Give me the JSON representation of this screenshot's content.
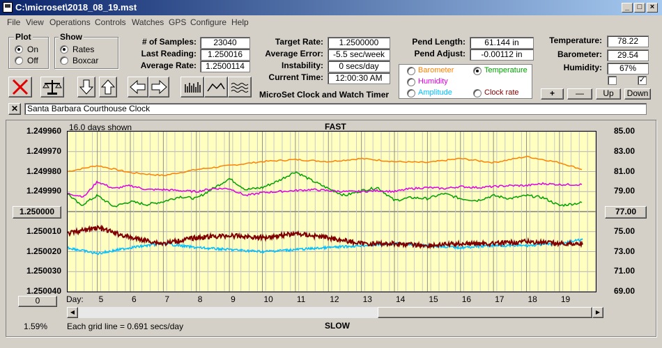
{
  "window": {
    "title": "C:\\microset\\2018_08_19.mst"
  },
  "menu": [
    "File",
    "View",
    "Operations",
    "Controls",
    "Watches",
    "GPS",
    "Configure",
    "Help"
  ],
  "plot_group": {
    "title": "Plot",
    "options": [
      "On",
      "Off"
    ],
    "selected": "On"
  },
  "show_group": {
    "title": "Show",
    "options": [
      "Rates",
      "Boxcar"
    ],
    "selected": "Rates"
  },
  "stats": {
    "samples_label": "# of Samples:",
    "samples_value": "23040",
    "last_label": "Last Reading:",
    "last_value": "1.250016",
    "avg_label": "Average Rate:",
    "avg_value": "1.2500114"
  },
  "targets": {
    "target_label": "Target Rate:",
    "target_value": "1.2500000",
    "error_label": "Average Error:",
    "error_value": "-5.5 sec/week",
    "instab_label": "Instability:",
    "instab_value": "0 secs/day",
    "time_label": "Current Time:",
    "time_value": "12:00:30 AM",
    "product_title": "MicroSet Clock and Watch Timer"
  },
  "pendulum": {
    "length_label": "Pend Length:",
    "length_value": "61.144 in",
    "adjust_label": "Pend Adjust:",
    "adjust_value": "-0.00112 in"
  },
  "sensor_select": {
    "options": [
      {
        "label": "Barometer",
        "color": "#ff8000"
      },
      {
        "label": "Temperature",
        "color": "#00a000"
      },
      {
        "label": "Humidity",
        "color": "#e000e0"
      },
      {
        "label": "Amplitude",
        "color": "#00c0ff"
      },
      {
        "label": "Clock rate",
        "color": "#800000"
      }
    ],
    "selected": "Temperature"
  },
  "env": {
    "temp_label": "Temperature:",
    "temp_value": "78.22",
    "baro_label": "Barometer:",
    "baro_value": "29.54",
    "hum_label": "Humidity:",
    "hum_value": "67%",
    "checkbox_left": false,
    "checkbox_right": true
  },
  "scale_buttons": {
    "plus": "+",
    "minus": "—",
    "up": "Up",
    "down": "Down"
  },
  "note": {
    "value": "Santa Barbara Courthouse Clock"
  },
  "chart": {
    "days_shown": "16.0 days shown",
    "top_label": "FAST",
    "bottom_label": "SLOW",
    "day_label": "Day:",
    "grid_note": "Each grid line = 0.691 secs/day",
    "left_center_button": "1.250000",
    "right_center_button": "77.00",
    "left_bottom_button": "0",
    "percent": "1.59%"
  },
  "chart_data": {
    "type": "line",
    "x_label": "Day:",
    "x_ticks": [
      5,
      6,
      7,
      8,
      9,
      10,
      11,
      12,
      13,
      14,
      15,
      16,
      17,
      18,
      19
    ],
    "xlim": [
      4.1,
      20.1
    ],
    "left_axis": {
      "ticks": [
        "1.249960",
        "1.249970",
        "1.249980",
        "1.249990",
        "1.250000",
        "1.250010",
        "1.250020",
        "1.250030",
        "1.250040"
      ],
      "ylim": [
        1.24996,
        1.25004
      ],
      "inverted": true
    },
    "right_axis": {
      "ticks": [
        "85.00",
        "83.00",
        "81.00",
        "79.00",
        "77.00",
        "75.00",
        "73.00",
        "71.00",
        "69.00"
      ],
      "ylim": [
        69,
        85
      ]
    },
    "grid": true,
    "series": [
      {
        "name": "Barometer",
        "color": "#ff8000",
        "axis": "right",
        "x": [
          4.1,
          5,
          6,
          7,
          8,
          9,
          10,
          11,
          12,
          13,
          14,
          15,
          16,
          17,
          18,
          19,
          19.7
        ],
        "y": [
          81.0,
          81.6,
          80.9,
          80.6,
          81.2,
          81.6,
          82.0,
          82.2,
          82.0,
          82.3,
          82.0,
          81.9,
          82.3,
          81.9,
          82.5,
          81.9,
          81.2
        ]
      },
      {
        "name": "Temperature",
        "color": "#00a000",
        "axis": "right",
        "x": [
          4.1,
          4.5,
          5,
          5.5,
          6,
          6.5,
          7,
          7.5,
          8,
          8.5,
          9,
          9.5,
          10,
          10.5,
          11,
          11.5,
          12,
          12.5,
          13,
          13.5,
          14,
          14.5,
          15,
          15.5,
          16,
          16.5,
          17,
          17.5,
          18,
          18.5,
          19,
          19.7
        ],
        "y": [
          78.8,
          77.6,
          78.6,
          77.5,
          78.0,
          77.7,
          78.0,
          78.5,
          78.3,
          79.3,
          80.3,
          79.2,
          79.4,
          80.1,
          81.0,
          80.1,
          79.3,
          78.6,
          79.1,
          79.4,
          78.1,
          78.4,
          78.3,
          78.8,
          78.3,
          78.1,
          78.6,
          78.3,
          78.6,
          78.4,
          77.6,
          77.9
        ]
      },
      {
        "name": "Humidity",
        "color": "#e000e0",
        "axis": "right",
        "x": [
          4.1,
          4.6,
          5,
          5.5,
          6,
          6.5,
          7,
          7.5,
          8,
          8.5,
          9,
          9.5,
          10,
          10.5,
          11,
          11.5,
          12,
          12.5,
          13,
          13.5,
          14,
          14.5,
          15,
          15.5,
          16,
          16.5,
          17,
          17.5,
          18,
          18.5,
          19,
          19.7
        ],
        "y": [
          78.8,
          78.5,
          80.0,
          79.3,
          79.6,
          79.2,
          79.2,
          79.1,
          79.0,
          79.3,
          79.3,
          78.6,
          78.9,
          79.0,
          79.1,
          79.2,
          79.1,
          79.0,
          79.0,
          79.1,
          79.0,
          79.3,
          79.4,
          79.3,
          79.5,
          79.4,
          79.5,
          79.6,
          79.6,
          79.8,
          79.7,
          79.7
        ]
      },
      {
        "name": "Amplitude",
        "color": "#00c0ff",
        "axis": "left",
        "x": [
          4.1,
          5,
          6,
          7,
          8,
          9,
          10,
          11,
          12,
          13,
          14,
          15,
          16,
          17,
          18,
          19,
          19.7
        ],
        "y": [
          1.250018,
          1.250021,
          1.250018,
          1.250016,
          1.250018,
          1.250019,
          1.25002,
          1.250019,
          1.250018,
          1.250017,
          1.250016,
          1.250017,
          1.250018,
          1.250017,
          1.250017,
          1.250016,
          1.250014
        ]
      },
      {
        "name": "Clock rate",
        "color": "#800000",
        "axis": "left",
        "x": [
          4.1,
          5,
          6,
          7,
          8,
          9,
          10,
          11,
          12,
          13,
          14,
          15,
          16,
          17,
          18,
          19,
          19.7
        ],
        "y": [
          1.250011,
          1.250008,
          1.250013,
          1.250016,
          1.250013,
          1.250012,
          1.250013,
          1.250011,
          1.250013,
          1.250016,
          1.250016,
          1.250017,
          1.250016,
          1.250016,
          1.250015,
          1.250016,
          1.250016
        ]
      }
    ]
  }
}
